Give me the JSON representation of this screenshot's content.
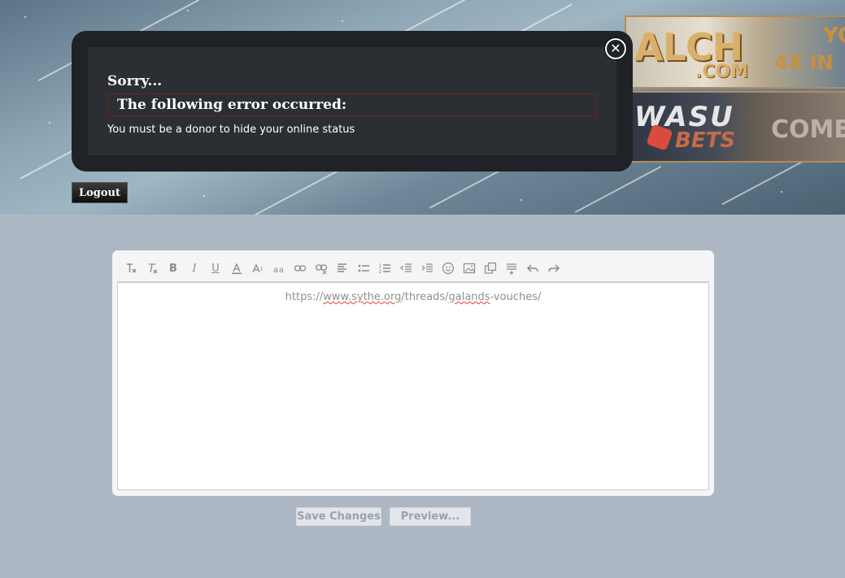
{
  "header": {
    "banners": {
      "top": {
        "brand": "ALCH",
        "domain": ".COM",
        "promo": "4X IN",
        "promo_tail": "YO"
      },
      "bottom": {
        "brand": "WASU",
        "sub": "BETS",
        "promo": "COME"
      }
    },
    "logout_label": "Logout"
  },
  "error_dialog": {
    "title": "Sorry...",
    "heading": "The following error occurred:",
    "message": "You must be a donor to hide your online status",
    "close_icon": "close-icon"
  },
  "editor": {
    "toolbar_icons": [
      "remove-format-icon",
      "clear-format-icon",
      "bold-icon",
      "italic-icon",
      "underline-icon",
      "font-color-icon",
      "font-size-icon",
      "font-family-icon",
      "link-icon",
      "unlink-icon",
      "align-icon",
      "bullet-list-icon",
      "numbered-list-icon",
      "outdent-icon",
      "indent-icon",
      "smiley-icon",
      "image-icon",
      "media-icon",
      "quote-icon",
      "undo-icon",
      "redo-icon"
    ],
    "content": {
      "prefix": "https://",
      "host": "www.sythe.org",
      "path_before": "/threads/",
      "path_word": "galands",
      "path_after": "-vouches/"
    }
  },
  "actions": {
    "save_label": "Save Changes",
    "preview_label": "Preview..."
  },
  "colors": {
    "page_bg": "#aeb8c4",
    "dialog_bg": "#1f2327",
    "dialog_inner": "#2b2f33",
    "error_border": "#7a1c1c"
  }
}
